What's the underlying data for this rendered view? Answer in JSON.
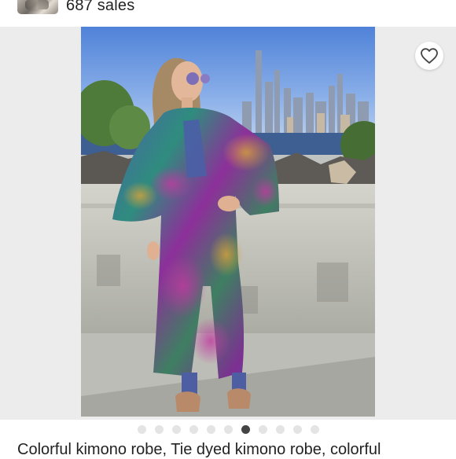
{
  "shop": {
    "sales_text": "687 sales",
    "thumbnail_icon": "shop-thumbnail-icon"
  },
  "gallery": {
    "favorite_icon": "heart-outline-icon",
    "image_count": 11,
    "active_index": 6,
    "accent_dot_color": "#444444",
    "inactive_dot_color": "#e4e4e4"
  },
  "product": {
    "title": "Colorful kimono robe, Tie dyed kimono robe, colorful"
  }
}
